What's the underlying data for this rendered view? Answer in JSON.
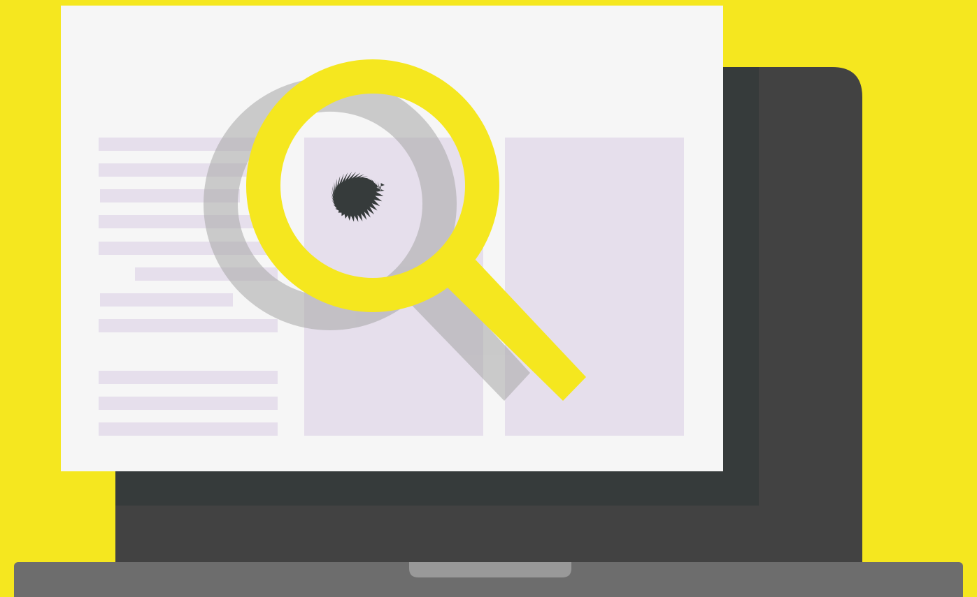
{
  "illustration": {
    "subject": "magnifying-glass-over-laptop-document",
    "icons": [
      "laptop-icon",
      "document-icon",
      "magnifying-glass-icon",
      "bug-icon"
    ]
  },
  "colors": {
    "background": "#f5e71f",
    "laptop_body": "#424242",
    "laptop_screen": "#363b3b",
    "laptop_base": "#6d6d6d",
    "trackpad_notch": "#999999",
    "paper": "#f6f6f6",
    "placeholder": "#e6dfec",
    "lens": "#f5e71f",
    "lens_shadow": "#a6a6a6",
    "bug": "#363b3b"
  }
}
